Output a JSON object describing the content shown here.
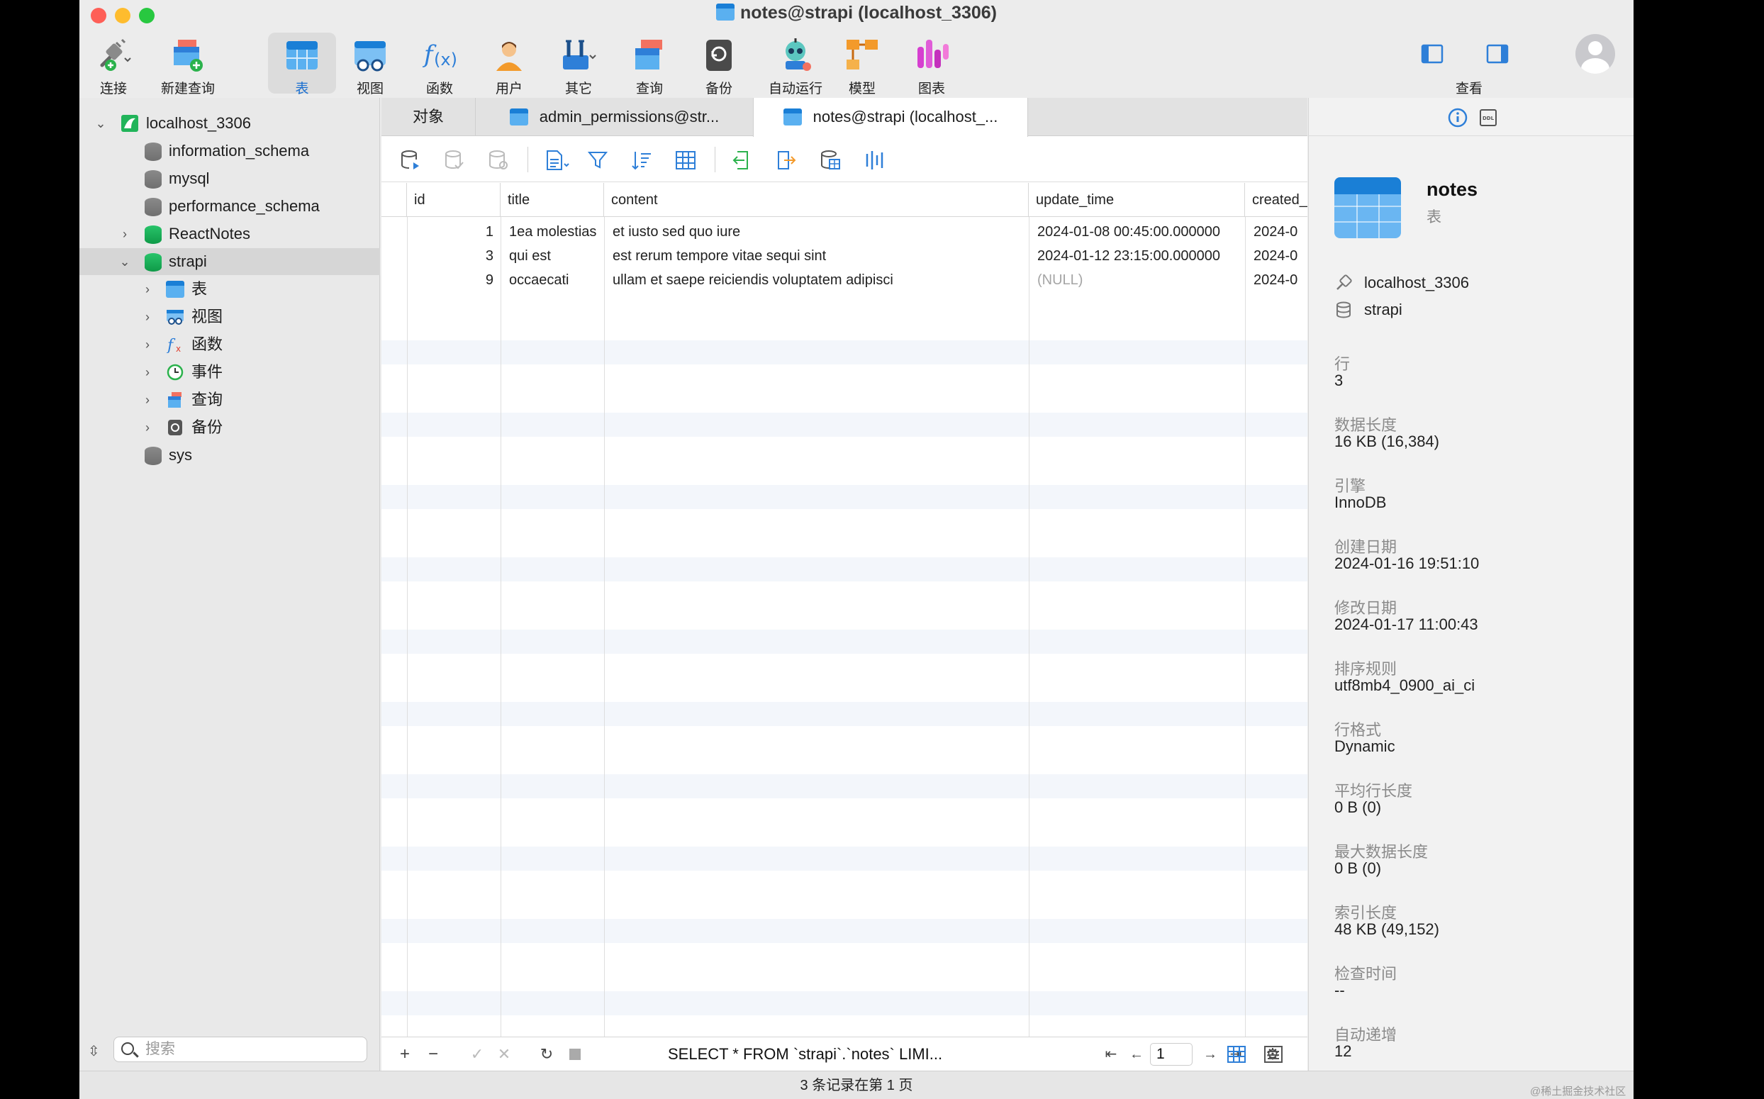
{
  "window": {
    "title": "notes@strapi (localhost_3306)"
  },
  "toolbar": {
    "items": [
      {
        "label": "连接",
        "icon": "plug-icon"
      },
      {
        "label": "新建查询",
        "icon": "new-query-icon"
      },
      {
        "label": "表",
        "icon": "table-icon",
        "selected": true
      },
      {
        "label": "视图",
        "icon": "view-icon"
      },
      {
        "label": "函数",
        "icon": "function-icon"
      },
      {
        "label": "用户",
        "icon": "user-icon"
      },
      {
        "label": "其它",
        "icon": "tools-icon"
      },
      {
        "label": "查询",
        "icon": "query-icon"
      },
      {
        "label": "备份",
        "icon": "backup-icon"
      },
      {
        "label": "自动运行",
        "icon": "robot-icon"
      },
      {
        "label": "模型",
        "icon": "model-icon"
      },
      {
        "label": "图表",
        "icon": "chart-icon"
      }
    ],
    "view_label": "查看"
  },
  "sidebar": {
    "connection": "localhost_3306",
    "databases": [
      "information_schema",
      "mysql",
      "performance_schema",
      "ReactNotes",
      "strapi"
    ],
    "strapi_children": [
      "表",
      "视图",
      "函数",
      "事件",
      "查询",
      "备份"
    ],
    "last_db": "sys",
    "search_placeholder": "搜索"
  },
  "tabs": [
    "对象",
    "admin_permissions@str...",
    "notes@strapi (localhost_..."
  ],
  "grid": {
    "columns": [
      "id",
      "title",
      "content",
      "update_time",
      "created_"
    ],
    "rows": [
      {
        "id": "1",
        "title": "1ea molestias",
        "content": "et iusto sed quo iure",
        "update_time": "2024-01-08 00:45:00.000000",
        "created": "2024-0"
      },
      {
        "id": "3",
        "title": "qui est",
        "content": "est rerum tempore vitae sequi sint",
        "update_time": "2024-01-12 23:15:00.000000",
        "created": "2024-0"
      },
      {
        "id": "9",
        "title": "occaecati",
        "content": "ullam et saepe reiciendis voluptatem adipisci",
        "update_time": "(NULL)",
        "created": "2024-0"
      }
    ],
    "sql": "SELECT * FROM `strapi`.`notes` LIMI...",
    "page": "1"
  },
  "info": {
    "name": "notes",
    "type": "表",
    "connection": "localhost_3306",
    "database": "strapi",
    "fields": [
      {
        "label": "行",
        "value": "3"
      },
      {
        "label": "数据长度",
        "value": "16 KB (16,384)"
      },
      {
        "label": "引擎",
        "value": "InnoDB"
      },
      {
        "label": "创建日期",
        "value": "2024-01-16 19:51:10"
      },
      {
        "label": "修改日期",
        "value": "2024-01-17 11:00:43"
      },
      {
        "label": "排序规则",
        "value": "utf8mb4_0900_ai_ci"
      },
      {
        "label": "行格式",
        "value": "Dynamic"
      },
      {
        "label": "平均行长度",
        "value": "0 B (0)"
      },
      {
        "label": "最大数据长度",
        "value": "0 B (0)"
      },
      {
        "label": "索引长度",
        "value": "48 KB (49,152)"
      },
      {
        "label": "检查时间",
        "value": "--"
      },
      {
        "label": "自动递增",
        "value": "12"
      }
    ]
  },
  "status": "3 条记录在第 1 页",
  "watermark": "@稀土掘金技术社区",
  "colors": {
    "accent": "#1a6fd0",
    "close": "#fe5f57",
    "minimize": "#febc2e",
    "zoom": "#28c840"
  }
}
